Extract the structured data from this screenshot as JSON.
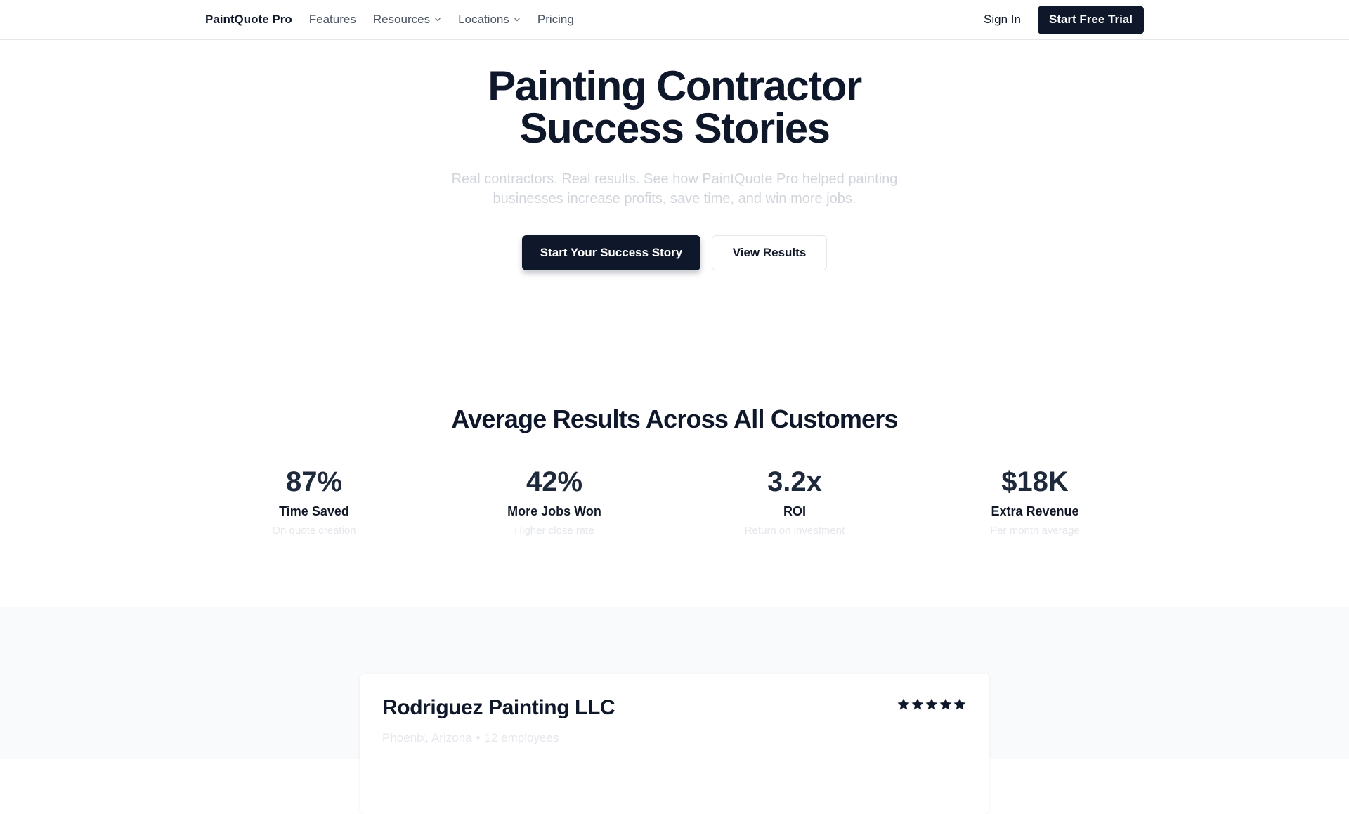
{
  "nav": {
    "brand": "PaintQuote Pro",
    "links": [
      {
        "label": "Features",
        "dropdown": false
      },
      {
        "label": "Resources",
        "dropdown": true
      },
      {
        "label": "Locations",
        "dropdown": true
      },
      {
        "label": "Pricing",
        "dropdown": false
      }
    ],
    "sign_in": "Sign In",
    "cta": "Start Free Trial"
  },
  "hero": {
    "title_line1": "Painting Contractor",
    "title_line2": "Success Stories",
    "subtitle": "Real contractors. Real results. See how PaintQuote Pro helped painting businesses increase profits, save time, and win more jobs.",
    "primary_cta": "Start Your Success Story",
    "secondary_cta": "View Results"
  },
  "results": {
    "title": "Average Results Across All Customers",
    "stats": [
      {
        "value": "87%",
        "label": "Time Saved",
        "desc": "On quote creation"
      },
      {
        "value": "42%",
        "label": "More Jobs Won",
        "desc": "Higher close rate"
      },
      {
        "value": "3.2x",
        "label": "ROI",
        "desc": "Return on investment"
      },
      {
        "value": "$18K",
        "label": "Extra Revenue",
        "desc": "Per month average"
      }
    ]
  },
  "story": {
    "company": "Rodriguez Painting LLC",
    "location": "Phoenix, Arizona",
    "separator": "•",
    "employees": "12 employees",
    "rating": 5
  },
  "colors": {
    "primary": "#0f172a",
    "muted_text": "#d1d5db",
    "border": "#e5e7eb",
    "section_bg": "#f9fafb"
  }
}
